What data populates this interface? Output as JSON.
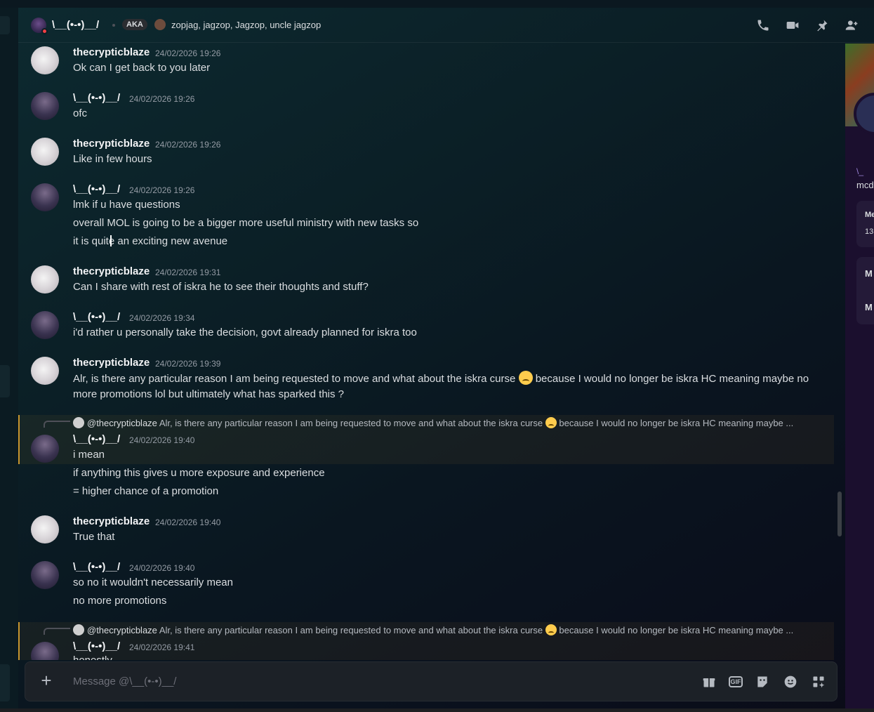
{
  "header": {
    "username": "\\__(•-•)__/",
    "aka_label": "AKA",
    "aka_names": "zopjag, jagzop, Jagzop, uncle jagzop",
    "icons": [
      "phone-call-icon",
      "video-call-icon",
      "pin-icon",
      "add-friend-icon"
    ]
  },
  "messages": [
    {
      "user": "thecrypticblaze",
      "time": "24/02/2026 19:26",
      "lines": [
        "Ok can I get back to you later"
      ]
    },
    {
      "user": "\\__(•-•)__/",
      "time": "24/02/2026 19:26",
      "lines": [
        "ofc"
      ]
    },
    {
      "user": "thecrypticblaze",
      "time": "24/02/2026 19:26",
      "lines": [
        "Like in few hours"
      ]
    },
    {
      "user": "\\__(•-•)__/",
      "time": "24/02/2026 19:26",
      "lines": [
        "lmk if u have questions",
        "overall MOL is going to be a bigger more useful ministry with new tasks so",
        "it is quite an exciting new avenue"
      ]
    },
    {
      "user": "thecrypticblaze",
      "time": "24/02/2026 19:31",
      "lines": [
        "Can I share with rest of iskra he to see their thoughts and stuff?"
      ]
    },
    {
      "user": "\\__(•-•)__/",
      "time": "24/02/2026 19:34",
      "lines": [
        "i'd rather u personally take the decision, govt already planned for iskra too"
      ]
    },
    {
      "user": "thecrypticblaze",
      "time": "24/02/2026 19:39",
      "text_before_emoji": "Alr, is there any particular reason I am being requested to move and what about the iskra curse",
      "text_after_emoji": "because I would no longer be iskra HC meaning maybe no more promotions lol but ultimately what has sparked this ?"
    },
    {
      "user": "\\__(•-•)__/",
      "time": "24/02/2026 19:40",
      "reply_to": "@thecrypticblaze",
      "reply_before_emoji": "Alr, is there any particular reason I am being requested to move and what about the iskra curse",
      "reply_after_emoji": "because I would no longer be iskra HC meaning maybe ...",
      "lines": [
        "i mean",
        "if anything this gives u more exposure and experience",
        "= higher chance of a promotion"
      ]
    },
    {
      "user": "thecrypticblaze",
      "time": "24/02/2026 19:40",
      "lines": [
        "True that"
      ]
    },
    {
      "user": "\\__(•-•)__/",
      "time": "24/02/2026 19:40",
      "lines": [
        "so no it wouldn't necessarily mean",
        "no more promotions"
      ]
    },
    {
      "user": "\\__(•-•)__/",
      "time": "24/02/2026 19:41",
      "reply_to": "@thecrypticblaze",
      "reply_before_emoji": "Alr, is there any particular reason I am being requested to move and what about the iskra curse",
      "reply_after_emoji": "because I would no longer be iskra HC meaning maybe ...",
      "lines": [
        "honestly"
      ]
    }
  ],
  "composer": {
    "placeholder": "Message @\\__(•-•)__/",
    "tools": [
      "gift-icon",
      "gif-icon",
      "sticker-icon",
      "emoji-icon",
      "apps-icon"
    ],
    "gif_label": "GIF"
  },
  "right_panel": {
    "handle": "\\_",
    "name": "mcd",
    "card1_title": "Me",
    "card1_value": "13",
    "card2_title1": "M",
    "card2_title2": "M"
  }
}
